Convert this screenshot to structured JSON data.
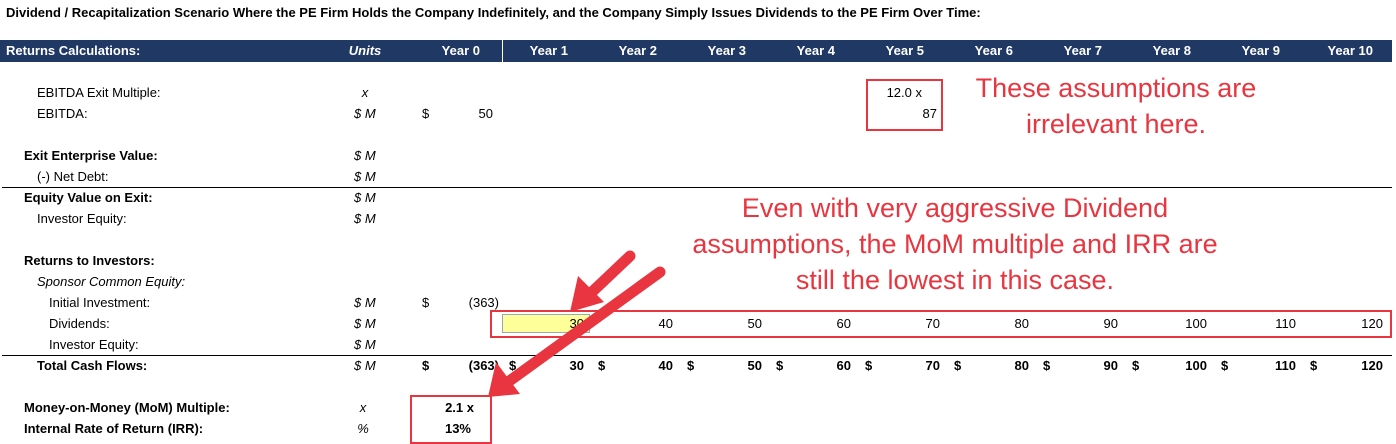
{
  "title": "Dividend / Recapitalization Scenario Where the PE Firm Holds the Company Indefinitely, and the Company Simply Issues Dividends to the PE Firm Over Time:",
  "header": {
    "label": "Returns Calculations:",
    "units": "Units",
    "years": [
      "Year 0",
      "Year 1",
      "Year 2",
      "Year 3",
      "Year 4",
      "Year 5",
      "Year 6",
      "Year 7",
      "Year 8",
      "Year 9",
      "Year 10"
    ]
  },
  "rows": {
    "exit_multiple": {
      "label": "EBITDA Exit Multiple:",
      "unit": "x",
      "year5": "12.0 x"
    },
    "ebitda": {
      "label": "EBITDA:",
      "unit": "$ M",
      "year0_cur": "$",
      "year0": "50",
      "year5": "87"
    },
    "exit_ev": {
      "label": "Exit Enterprise Value:",
      "unit": "$ M"
    },
    "net_debt": {
      "label": "(-) Net Debt:",
      "unit": "$ M"
    },
    "equity_exit": {
      "label": "Equity Value on Exit:",
      "unit": "$ M"
    },
    "investor_equity_1": {
      "label": "Investor Equity:",
      "unit": "$ M"
    },
    "returns": {
      "label": "Returns to Investors:"
    },
    "sponsor": {
      "label": "Sponsor Common Equity:"
    },
    "initial_investment": {
      "label": "Initial Investment:",
      "unit": "$ M",
      "year0_cur": "$",
      "year0": "(363)"
    },
    "dividends": {
      "label": "Dividends:",
      "unit": "$ M",
      "values": [
        "30",
        "40",
        "50",
        "60",
        "70",
        "80",
        "90",
        "100",
        "110",
        "120"
      ]
    },
    "investor_equity_2": {
      "label": "Investor Equity:",
      "unit": "$ M"
    },
    "total_cf": {
      "label": "Total Cash Flows:",
      "unit": "$ M",
      "cur": "$",
      "year0": "(363)",
      "values": [
        "30",
        "40",
        "50",
        "60",
        "70",
        "80",
        "90",
        "100",
        "110",
        "120"
      ]
    },
    "mom": {
      "label": "Money-on-Money (MoM) Multiple:",
      "unit": "x",
      "value": "2.1 x"
    },
    "irr": {
      "label": "Internal Rate of Return (IRR):",
      "unit": "%",
      "value": "13%"
    }
  },
  "annotations": {
    "top": [
      "These assumptions are",
      "irrelevant here."
    ],
    "middle": [
      "Even with very aggressive Dividend",
      "assumptions, the MoM multiple and IRR are",
      "still the lowest in this case."
    ]
  },
  "colors": {
    "header_bg": "#1f3864",
    "annotation": "#e8353f",
    "input_cell": "#ffff99"
  }
}
